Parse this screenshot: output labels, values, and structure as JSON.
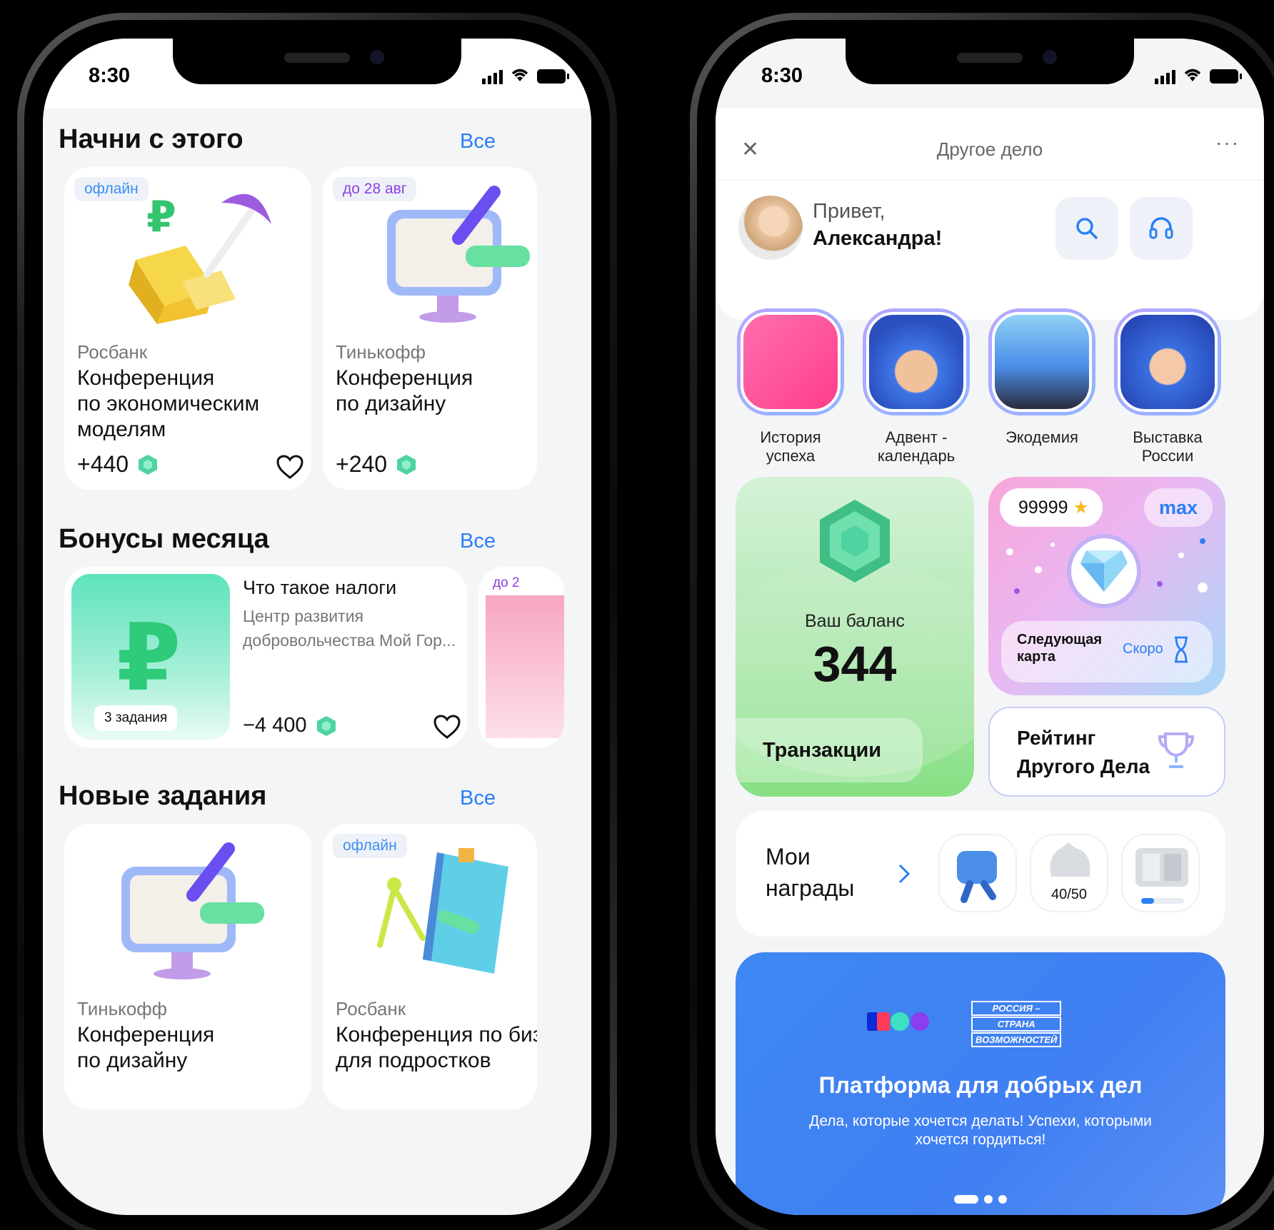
{
  "status": {
    "time": "8:30"
  },
  "left": {
    "sections": [
      {
        "title": "Начни с этого",
        "all": "Все"
      },
      {
        "title": "Бонусы месяца",
        "all": "Все"
      },
      {
        "title": "Новые задания",
        "all": "Все"
      }
    ],
    "start_cards": [
      {
        "tag": "офлайн",
        "org": "Росбанк",
        "name_lines": [
          "Конференция",
          "по экономическим",
          "моделям"
        ],
        "points": "+440"
      },
      {
        "tag": "до 28 авг",
        "org": "Тинькофф",
        "name_lines": [
          "Конференция",
          "по дизайну"
        ],
        "points": "+240"
      }
    ],
    "bonus_card": {
      "badge": "3 задания",
      "title": "Что такое налоги",
      "org_lines": [
        "Центр развития",
        "добровольчества Мой Гор..."
      ],
      "points": "−4 400",
      "peek_tag": "до 2"
    },
    "task_cards": [
      {
        "org": "Тинькофф",
        "name_lines": [
          "Конференция",
          "по дизайну"
        ]
      },
      {
        "tag": "офлайн",
        "org": "Росбанк",
        "name_lines": [
          "Конференция по биз",
          "для подростков"
        ]
      }
    ]
  },
  "right": {
    "header_title": "Другое дело",
    "greeting_1": "Привет,",
    "greeting_2": "Александра!",
    "stories": [
      {
        "lines": [
          "История",
          "успеха"
        ]
      },
      {
        "lines": [
          "Адвент -",
          "календарь"
        ]
      },
      {
        "lines": [
          "Экодемия"
        ]
      },
      {
        "lines": [
          "Выставка",
          "России"
        ]
      }
    ],
    "balance": {
      "label": "Ваш баланс",
      "value": "344",
      "transactions": "Транзакции"
    },
    "card": {
      "score": "99999",
      "max": "max",
      "next_lines": [
        "Следующая",
        "карта"
      ],
      "soon": "Скоро"
    },
    "rating_lines": [
      "Рейтинг",
      "Другого Дела"
    ],
    "awards": {
      "title_lines": [
        "Мои",
        "награды"
      ],
      "progress_label": "40/50",
      "progress": 0.3
    },
    "banner": {
      "logo_lines": [
        "РОССИЯ –",
        "СТРАНА",
        "ВОЗМОЖНОСТЕЙ"
      ],
      "title": "Платформа для добрых дел",
      "subtitle": "Дела, которые хочется делать! Успехи, которыми хочется гордиться!"
    }
  },
  "colors": {
    "accent": "#2a7ff5",
    "gem": "#4fd3a0",
    "banner": "#3f88f2"
  }
}
